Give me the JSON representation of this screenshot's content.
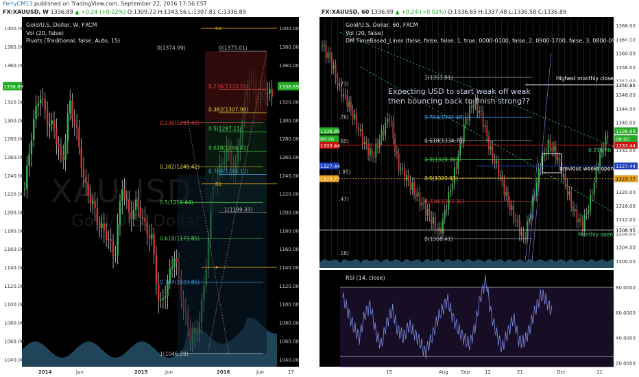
{
  "topbar": {
    "author": "PerryCM13",
    "published": "published on TradingView.com, September 22, 2016 17:56 EST"
  },
  "left": {
    "header": {
      "symbol": "FX:XAUUSD, W",
      "price": "1336.89",
      "change": "▲ +0.24 (+0.02%)",
      "ohlc": "O:1309.72 H:1343.56 L:1307.81 C:1336.89"
    },
    "title": "Gold/U.S. Dollar, W, FXCM",
    "indicators": [
      "Vol (20, false)",
      "Pivots (Traditional, false, Auto, 15)"
    ],
    "watermark_symbol": "XAUUSD",
    "watermark_name": "Gold/U.S. Dollar",
    "ylabels": [
      "1400.00",
      "1380.00",
      "1360.00",
      "1340.00",
      "1320.00",
      "1300.00",
      "1280.00",
      "1260.00",
      "1240.00",
      "1220.00",
      "1200.00",
      "1180.00",
      "1160.00",
      "1140.00",
      "1120.00",
      "1100.00",
      "1080.00",
      "1060.00",
      "1040.00"
    ],
    "xlabels": [
      "2014",
      "Jun",
      "2015",
      "Jun",
      "2016",
      "Jun",
      "17"
    ],
    "price_tag": "1336.89",
    "pivots": [
      {
        "label": "R2",
        "price": 1400
      },
      {
        "label": "R1",
        "price": 1231
      },
      {
        "label": "P",
        "price": 1140
      }
    ],
    "fib_right": [
      {
        "label": "0(1374.99)",
        "price": 1374.99,
        "color": "#bdbdbd"
      },
      {
        "label": "0(1375.01)",
        "price": 1375.01,
        "color": "#bdbdbd"
      },
      {
        "label": "0.236(1333.55)",
        "price": 1333.55,
        "color": "#e04040"
      },
      {
        "label": "0.382(1307.90)",
        "price": 1307.9,
        "color": "#e6d23a"
      },
      {
        "label": "0.5(1287.11)",
        "price": 1287.11,
        "color": "#4fd84f"
      },
      {
        "label": "0.618(1266.41)",
        "price": 1266.41,
        "color": "#4fd84f"
      },
      {
        "label": "0.764(1241.12)",
        "price": 1241.12,
        "color": "#3aa0e6"
      },
      {
        "label": "1(1199.33)",
        "price": 1199.33,
        "color": "#bdbdbd"
      }
    ],
    "fib_left": [
      {
        "label": "0.236(1297.42)",
        "price": 1297.42,
        "color": "#e04040"
      },
      {
        "label": "0.382(1249.42)",
        "price": 1249.42,
        "color": "#e6d23a"
      },
      {
        "label": "0.5(1210.64)",
        "price": 1210.64,
        "color": "#4fd84f"
      },
      {
        "label": "0.618(1171.85)",
        "price": 1171.85,
        "color": "#4fd84f"
      },
      {
        "label": "0.764(1123.85)",
        "price": 1123.85,
        "color": "#3aa0e6"
      },
      {
        "label": "1(1046.28)",
        "price": 1046.28,
        "color": "#bdbdbd"
      }
    ]
  },
  "right": {
    "header": {
      "symbol": "FX:XAUUSD, 60",
      "price": "1336.89",
      "change": "▲ +0.24 (+0.02%)",
      "ohlc": "O:1336.65 H:1337.48 L:1336.58 C:1336.89"
    },
    "title": "Gold/U.S. Dollar, 60, FXCM",
    "indicators": [
      "Vol (20, false)",
      "DM TimeBased_Lines (false, false, false, 1, true, 0000-0100, false, 2, 0900-1700, false, 3, 0800-0900, fals"
    ],
    "ylabels": [
      "1368.00",
      "1364.00",
      "1360.00",
      "1356.00",
      "1352.00",
      "1348.00",
      "1344.00",
      "1340.00",
      "1336.00",
      "1332.00",
      "1328.00",
      "1324.00",
      "1320.00",
      "1316.00",
      "1312.00",
      "1308.00",
      "1304.00",
      "1300.00"
    ],
    "xlabels": [
      "15",
      "Aug",
      "Sep",
      "12",
      "21",
      "Oct",
      "11"
    ],
    "tags": [
      {
        "text": "1350.85",
        "price": 1350.85,
        "bg": "#ffffff",
        "fg": "#000"
      },
      {
        "text": "1336.89",
        "price": 1337.6,
        "bg": "#22aa22",
        "fg": "#fff"
      },
      {
        "text": "06:00",
        "price": 1335.3,
        "bg": "#22aa22",
        "fg": "#fff"
      },
      {
        "text": "1333.44",
        "price": 1333.44,
        "bg": "#cc1111",
        "fg": "#fff"
      },
      {
        "text": "1327.44",
        "price": 1327.44,
        "bg": "#1a3fbf",
        "fg": "#fff"
      },
      {
        "text": "1323.77",
        "price": 1323.77,
        "bg": "#e6a21a",
        "fg": "#000"
      },
      {
        "text": "1308.95",
        "price": 1308.95,
        "bg": "#ffffff",
        "fg": "#000"
      }
    ],
    "left_tags": [
      {
        "text": "1336.89",
        "price": 1337.6,
        "bg": "#22aa22"
      },
      {
        "text": "06:00",
        "price": 1335.3,
        "bg": "#22aa22"
      },
      {
        "text": "1333.44",
        "price": 1333.44,
        "bg": "#cc1111"
      },
      {
        "text": "1327.44",
        "price": 1327.44,
        "bg": "#1a3fbf"
      },
      {
        "text": "1323.77",
        "price": 1323.77,
        "bg": "#e6a21a"
      }
    ],
    "fibs": [
      {
        "label": "0.764(1341.48)",
        "price": 1341.48,
        "color": "#3aa0e6"
      },
      {
        "label": "0.618(1334.78)",
        "price": 1334.78,
        "color": "#cfcfcf"
      },
      {
        "label": "0.5(1329.36)",
        "price": 1329.36,
        "color": "#4fd84f"
      },
      {
        "label": "0.5(1323.93)",
        "price": 1323.93,
        "color": "#e6d23a"
      },
      {
        "label": "0.236(1317.31)",
        "price": 1317.31,
        "color": "#e04040"
      },
      {
        "label": "0(1306.41)",
        "price": 1306.41,
        "color": "#bdbdbd"
      },
      {
        "label": "1(1353.01)",
        "price": 1353.01,
        "color": "#bdbdbd"
      }
    ],
    "partial_labels": [
      {
        "text": ".73)",
        "price": 1351.2
      },
      {
        "text": ".26)",
        "price": 1341.6
      },
      {
        "text": ".60)",
        "price": 1334.6
      },
      {
        "text": "(.95)",
        "price": 1325.8
      },
      {
        "text": ".47)",
        "price": 1318.0
      },
      {
        "text": ".16)",
        "price": 1302.4
      }
    ],
    "annotations": {
      "main": "Expecting USD to start weak off weak then bouncing back to finish strong??",
      "highest_monthly_close": "Highest monthly close",
      "fib_236": "0.236 fib",
      "prev_weeks_open": "previous weeks open",
      "monthly_open": "Monthly open"
    },
    "rsi": {
      "title": "RSI (14, close)",
      "ylabels": [
        "80.0000",
        "60.0000",
        "40.0000",
        "20.0000"
      ]
    }
  },
  "chart_data": [
    {
      "type": "line",
      "title": "Gold/U.S. Dollar, W, FXCM",
      "x": [
        "2014",
        "Jun",
        "2015",
        "Jun",
        "2016",
        "Jun",
        "17"
      ],
      "series": [
        {
          "values": [
            1225,
            1290,
            1330,
            1300,
            1290,
            1250,
            1320,
            1285,
            1230,
            1210,
            1185,
            1175,
            1150,
            1230,
            1195,
            1210,
            1185,
            1170,
            1095,
            1120,
            1155,
            1105,
            1065,
            1070,
            1120,
            1225,
            1245,
            1270,
            1240,
            1300,
            1350,
            1320,
            1335,
            1325
          ]
        }
      ],
      "ylim": [
        1032,
        1412
      ]
    },
    {
      "type": "line",
      "title": "Gold/U.S. Dollar, 60, FXCM",
      "x": [
        "15",
        "Aug",
        "Sep",
        "12",
        "21",
        "Oct",
        "11"
      ],
      "series": [
        {
          "values": [
            1362,
            1358,
            1350,
            1346,
            1340,
            1334,
            1330,
            1336,
            1342,
            1328,
            1324,
            1320,
            1316,
            1312,
            1308,
            1318,
            1328,
            1340,
            1346,
            1342,
            1332,
            1326,
            1318,
            1312,
            1306,
            1316,
            1328,
            1334,
            1330,
            1322,
            1314,
            1310,
            1318,
            1330,
            1336
          ]
        }
      ],
      "ylim": [
        1298,
        1370
      ]
    },
    {
      "type": "line",
      "title": "RSI (14, close)",
      "series": [
        {
          "values": [
            72,
            60,
            48,
            40,
            58,
            66,
            44,
            34,
            52,
            62,
            46,
            40,
            50,
            44,
            36,
            28,
            38,
            52,
            62,
            70,
            56,
            46,
            40,
            34,
            48,
            72,
            86,
            58,
            42,
            32,
            44,
            56,
            38,
            36,
            48,
            62,
            74,
            70,
            60
          ]
        }
      ],
      "ylim": [
        18,
        92
      ]
    }
  ]
}
